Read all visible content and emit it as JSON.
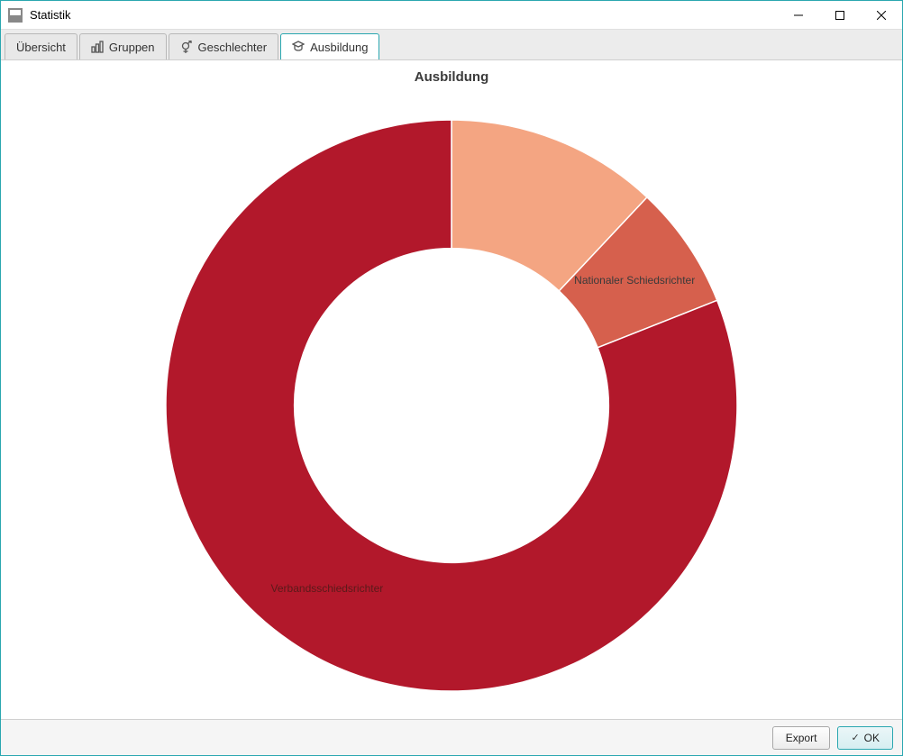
{
  "window": {
    "title": "Statistik"
  },
  "tabs": [
    {
      "label": "Übersicht"
    },
    {
      "label": "Gruppen"
    },
    {
      "label": "Geschlechter"
    },
    {
      "label": "Ausbildung"
    }
  ],
  "active_tab_index": 3,
  "footer": {
    "export_label": "Export",
    "ok_label": "OK"
  },
  "chart_data": {
    "type": "pie",
    "title": "Ausbildung",
    "series": [
      {
        "name": "",
        "value": 12,
        "color": "#f4a582"
      },
      {
        "name": "Nationaler Schiedsrichter",
        "value": 7,
        "color": "#d6604d"
      },
      {
        "name": "Verbandsschiedsrichter",
        "value": 81,
        "color": "#b2182b"
      }
    ],
    "inner_radius_ratio": 0.55
  }
}
